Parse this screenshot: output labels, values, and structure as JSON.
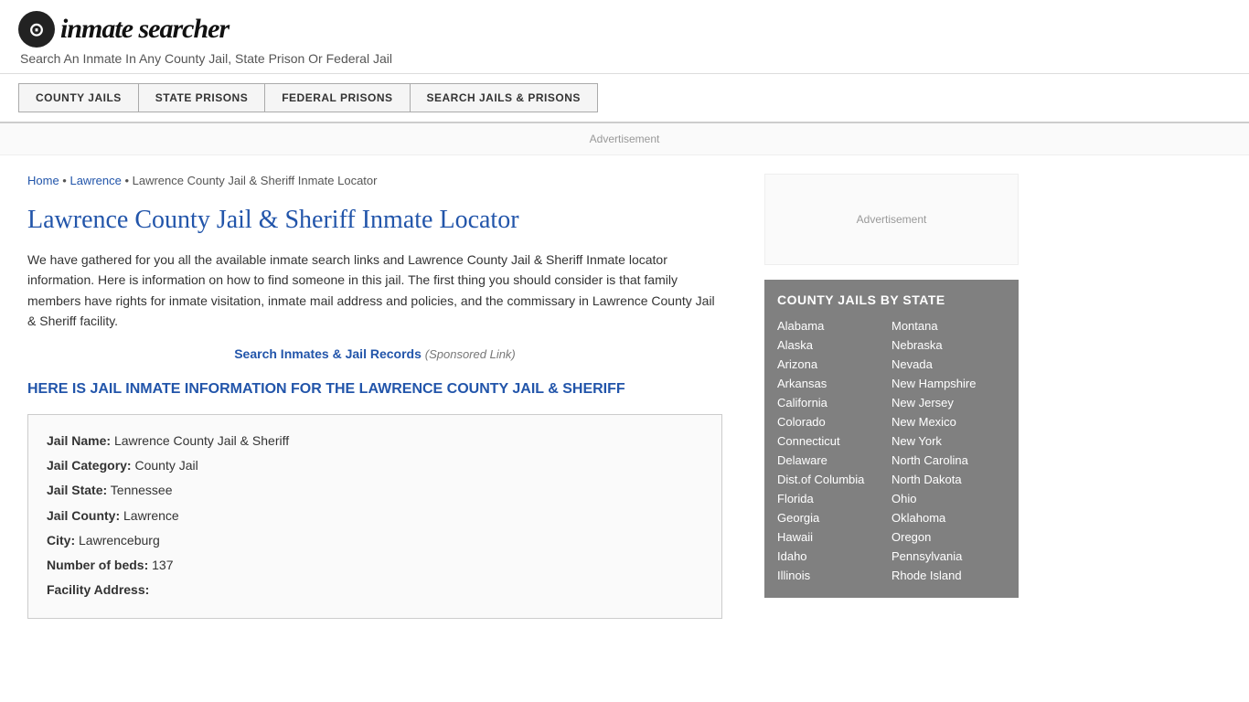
{
  "header": {
    "logo_icon": "🔍",
    "logo_text": "inmate searcher",
    "tagline": "Search An Inmate In Any County Jail, State Prison Or Federal Jail"
  },
  "nav": {
    "items": [
      {
        "label": "COUNTY JAILS"
      },
      {
        "label": "STATE PRISONS"
      },
      {
        "label": "FEDERAL PRISONS"
      },
      {
        "label": "SEARCH JAILS & PRISONS"
      }
    ]
  },
  "ad_banner": "Advertisement",
  "breadcrumb": {
    "home": "Home",
    "separator1": " • ",
    "lawrence": "Lawrence",
    "separator2": " • ",
    "current": "Lawrence County Jail & Sheriff Inmate Locator"
  },
  "page_title": "Lawrence County Jail & Sheriff Inmate Locator",
  "body_text": "We have gathered for you all the available inmate search links and Lawrence County Jail & Sheriff Inmate locator information. Here is information on how to find someone in this jail. The first thing you should consider is that family members have rights for inmate visitation, inmate mail address and policies, and the commissary in Lawrence County Jail & Sheriff facility.",
  "sponsored_link": {
    "label": "Search Inmates & Jail Records",
    "suffix": "(Sponsored Link)"
  },
  "section_heading": "HERE IS JAIL INMATE INFORMATION FOR THE LAWRENCE COUNTY JAIL & SHERIFF",
  "info_box": {
    "jail_name_label": "Jail Name:",
    "jail_name_value": "Lawrence County Jail & Sheriff",
    "jail_category_label": "Jail Category:",
    "jail_category_value": "County Jail",
    "jail_state_label": "Jail State:",
    "jail_state_value": "Tennessee",
    "jail_county_label": "Jail County:",
    "jail_county_value": "Lawrence",
    "city_label": "City:",
    "city_value": "Lawrenceburg",
    "beds_label": "Number of beds:",
    "beds_value": "137",
    "address_label": "Facility Address:"
  },
  "sidebar": {
    "ad_label": "Advertisement",
    "county_jails_title": "COUNTY JAILS BY STATE",
    "states_col1": [
      "Alabama",
      "Alaska",
      "Arizona",
      "Arkansas",
      "California",
      "Colorado",
      "Connecticut",
      "Delaware",
      "Dist.of Columbia",
      "Florida",
      "Georgia",
      "Hawaii",
      "Idaho",
      "Illinois"
    ],
    "states_col2": [
      "Montana",
      "Nebraska",
      "Nevada",
      "New Hampshire",
      "New Jersey",
      "New Mexico",
      "New York",
      "North Carolina",
      "North Dakota",
      "Ohio",
      "Oklahoma",
      "Oregon",
      "Pennsylvania",
      "Rhode Island"
    ]
  }
}
